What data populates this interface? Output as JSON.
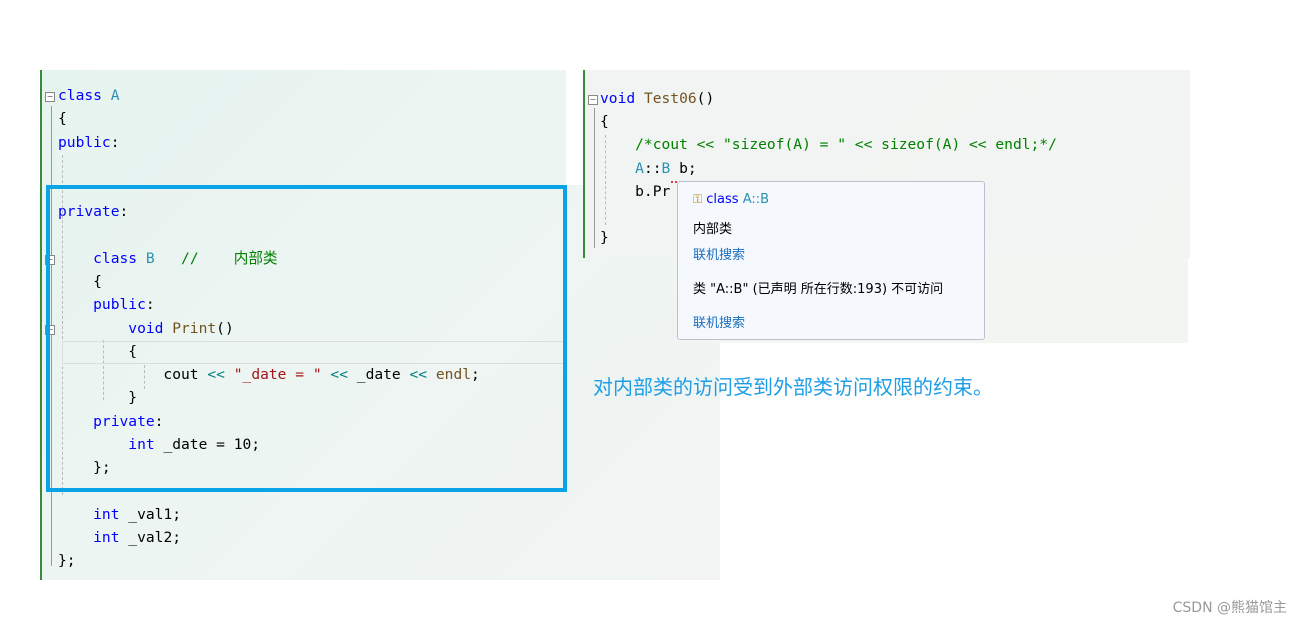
{
  "left_code": {
    "lines": [
      [
        {
          "t": "class ",
          "c": "kw"
        },
        {
          "t": "A",
          "c": "ty"
        }
      ],
      [
        {
          "t": "{",
          "c": "pl"
        }
      ],
      [
        {
          "t": "public",
          "c": "kw"
        },
        {
          "t": ":",
          "c": "pl"
        }
      ],
      [],
      [],
      [
        {
          "t": "private",
          "c": "kw"
        },
        {
          "t": ":",
          "c": "pl"
        }
      ],
      [],
      [
        {
          "t": "    class ",
          "c": "kw"
        },
        {
          "t": "B",
          "c": "ty"
        },
        {
          "t": "   //    内部类",
          "c": "cm"
        }
      ],
      [
        {
          "t": "    {",
          "c": "pl"
        }
      ],
      [
        {
          "t": "    public",
          "c": "kw"
        },
        {
          "t": ":",
          "c": "pl"
        }
      ],
      [
        {
          "t": "        void ",
          "c": "kw"
        },
        {
          "t": "Print",
          "c": "fn"
        },
        {
          "t": "()",
          "c": "pl"
        }
      ],
      [
        {
          "t": "        {",
          "c": "pl"
        }
      ],
      [
        {
          "t": "            cout ",
          "c": "pl"
        },
        {
          "t": "<<",
          "c": "op"
        },
        {
          "t": " ",
          "c": "pl"
        },
        {
          "t": "\"_date = \"",
          "c": "st"
        },
        {
          "t": " ",
          "c": "pl"
        },
        {
          "t": "<<",
          "c": "op"
        },
        {
          "t": " _date ",
          "c": "pl"
        },
        {
          "t": "<<",
          "c": "op"
        },
        {
          "t": " ",
          "c": "pl"
        },
        {
          "t": "endl",
          "c": "fn"
        },
        {
          "t": ";",
          "c": "pl"
        }
      ],
      [
        {
          "t": "        }",
          "c": "pl"
        }
      ],
      [
        {
          "t": "    private",
          "c": "kw"
        },
        {
          "t": ":",
          "c": "pl"
        }
      ],
      [
        {
          "t": "        int",
          "c": "kw"
        },
        {
          "t": " _date = 10;",
          "c": "pl"
        }
      ],
      [
        {
          "t": "    };",
          "c": "pl"
        }
      ],
      [],
      [
        {
          "t": "    int",
          "c": "kw"
        },
        {
          "t": " _val1;",
          "c": "pl"
        }
      ],
      [
        {
          "t": "    int",
          "c": "kw"
        },
        {
          "t": " _val2;",
          "c": "pl"
        }
      ],
      [
        {
          "t": "};",
          "c": "pl"
        }
      ]
    ]
  },
  "right_code": {
    "lines": [
      [
        {
          "t": "void ",
          "c": "kw"
        },
        {
          "t": "Test06",
          "c": "fn"
        },
        {
          "t": "()",
          "c": "pl"
        }
      ],
      [
        {
          "t": "{",
          "c": "pl"
        }
      ],
      [
        {
          "t": "    /*cout << \"sizeof(A) = \" << sizeof(A) << endl;*/",
          "c": "cm"
        }
      ],
      [
        {
          "t": "    A",
          "c": "ty"
        },
        {
          "t": "::",
          "c": "pl"
        },
        {
          "t": "B",
          "c": "ty"
        },
        {
          "t": " b;",
          "c": "pl"
        }
      ],
      [
        {
          "t": "    b.Pr",
          "c": "pl"
        }
      ],
      [],
      [
        {
          "t": "}",
          "c": "pl"
        }
      ]
    ]
  },
  "tooltip": {
    "icon": "class-private-icon",
    "signature_keyword": "class ",
    "signature_name": "A::B",
    "description": "内部类",
    "search_link_1": "联机搜索",
    "error_message": "类 \"A::B\" (已声明 所在行数:193) 不可访问",
    "search_link_2": "联机搜索"
  },
  "caption": "对内部类的访问受到外部类访问权限的约束。",
  "watermark": "CSDN @熊猫馆主",
  "colors": {
    "highlight_box": "#0aa4e6",
    "caption": "#1e9de6",
    "keyword": "#0000ff",
    "type": "#2b91af",
    "comment": "#008000",
    "string": "#a31515"
  }
}
